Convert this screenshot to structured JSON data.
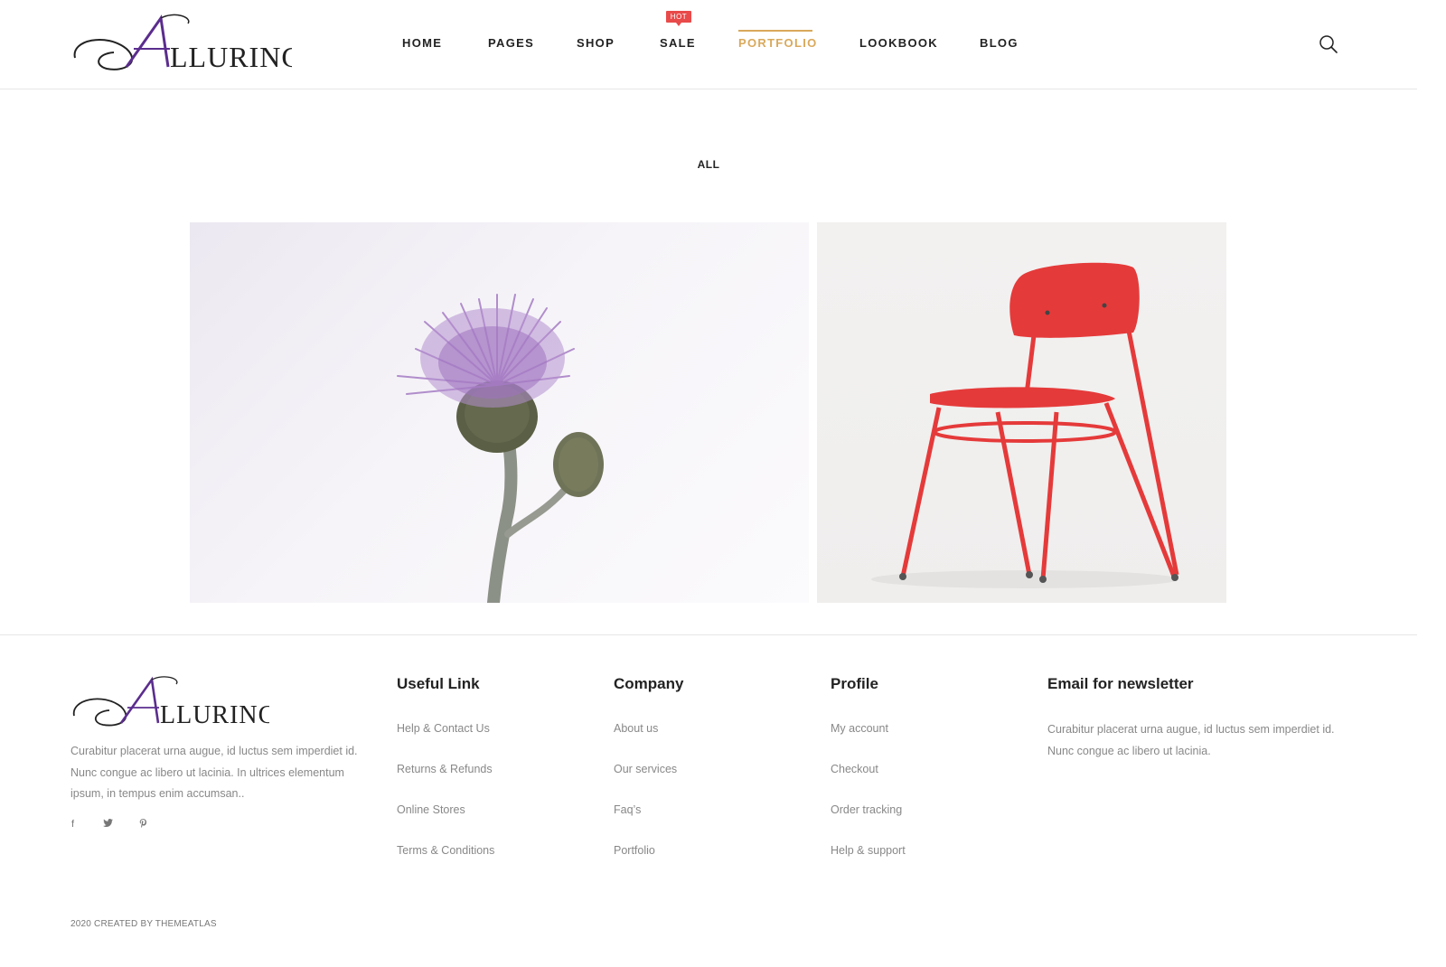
{
  "brand": {
    "name": "ALLURING",
    "accent": "#d9a95c",
    "logo_purple": "#5b2d8e"
  },
  "nav": {
    "items": [
      {
        "label": "HOME"
      },
      {
        "label": "PAGES"
      },
      {
        "label": "SHOP"
      },
      {
        "label": "SALE",
        "badge": "HOT"
      },
      {
        "label": "PORTFOLIO",
        "active": true
      },
      {
        "label": "LOOKBOOK"
      },
      {
        "label": "BLOG"
      }
    ],
    "search_icon": "search-icon"
  },
  "portfolio": {
    "filter": "ALL",
    "items": [
      {
        "name": "thistle flower"
      },
      {
        "name": "red chair"
      }
    ]
  },
  "footer": {
    "about": "Curabitur placerat urna augue, id luctus sem imperdiet id. Nunc congue ac libero ut lacinia. In ultrices elementum ipsum, in tempus enim accumsan..",
    "social": [
      "f",
      "twitter-icon",
      "pinterest-icon"
    ],
    "columns": [
      {
        "title": "Useful Link",
        "links": [
          "Help & Contact Us",
          "Returns & Refunds",
          "Online Stores",
          "Terms & Conditions"
        ]
      },
      {
        "title": "Company",
        "links": [
          "About us",
          "Our services",
          "Faq’s",
          "Portfolio"
        ]
      },
      {
        "title": "Profile",
        "links": [
          "My account",
          "Checkout",
          "Order tracking",
          "Help & support"
        ]
      }
    ],
    "newsletter": {
      "title": "Email for newsletter",
      "text": "Curabitur placerat urna augue, id luctus sem imperdiet id. Nunc congue ac libero ut lacinia."
    },
    "copyright": "2020 CREATED BY THEMEATLAS"
  }
}
